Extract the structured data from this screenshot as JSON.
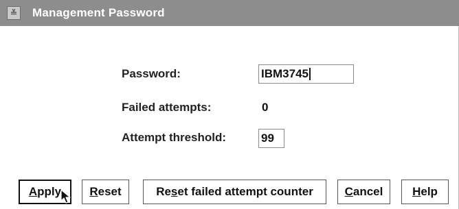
{
  "window": {
    "title": "Management Password",
    "system_menu_glyph": "≚"
  },
  "form": {
    "password_label": "Password:",
    "password_value": "IBM3745",
    "failed_attempts_label": "Failed attempts:",
    "failed_attempts_value": "0",
    "attempt_threshold_label": "Attempt threshold:",
    "attempt_threshold_value": "99"
  },
  "buttons": {
    "apply": {
      "pre": "",
      "mnemonic": "A",
      "post": "pply"
    },
    "reset": {
      "pre": "",
      "mnemonic": "R",
      "post": "eset"
    },
    "reset_counter": {
      "pre": "Re",
      "mnemonic": "s",
      "post": "et failed attempt counter"
    },
    "cancel": {
      "pre": "",
      "mnemonic": "C",
      "post": "ancel"
    },
    "help": {
      "pre": "",
      "mnemonic": "H",
      "post": "elp"
    }
  },
  "colors": {
    "titlebar": "#8d8d8d",
    "background": "#ffffff",
    "text": "#222222"
  },
  "icons": {
    "system_menu": "system-menu-icon",
    "pointer": "mouse-pointer-icon"
  }
}
